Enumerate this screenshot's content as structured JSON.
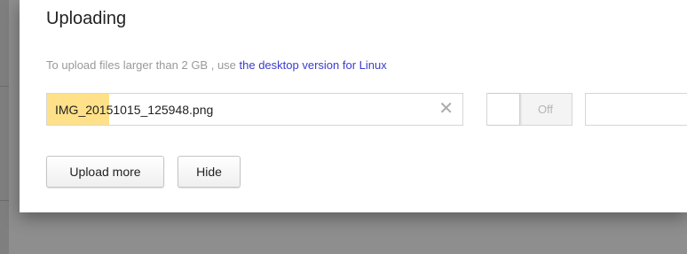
{
  "dialog": {
    "title": "Uploading",
    "hint": {
      "prefix": "To upload files larger than 2 GB , use ",
      "link_text": "the desktop version for Linux"
    }
  },
  "upload": {
    "file_name": "IMG_20151015_125948.png",
    "progress_percent": 15,
    "cancel_icon": "close-icon",
    "toggle_label": "Off",
    "extra_field_value": ""
  },
  "buttons": {
    "upload_more": "Upload more",
    "hide": "Hide"
  },
  "colors": {
    "progress": "#ffe18a",
    "link": "#3b3bd0",
    "hint": "#999999",
    "overlay": "#8e8e8e"
  }
}
